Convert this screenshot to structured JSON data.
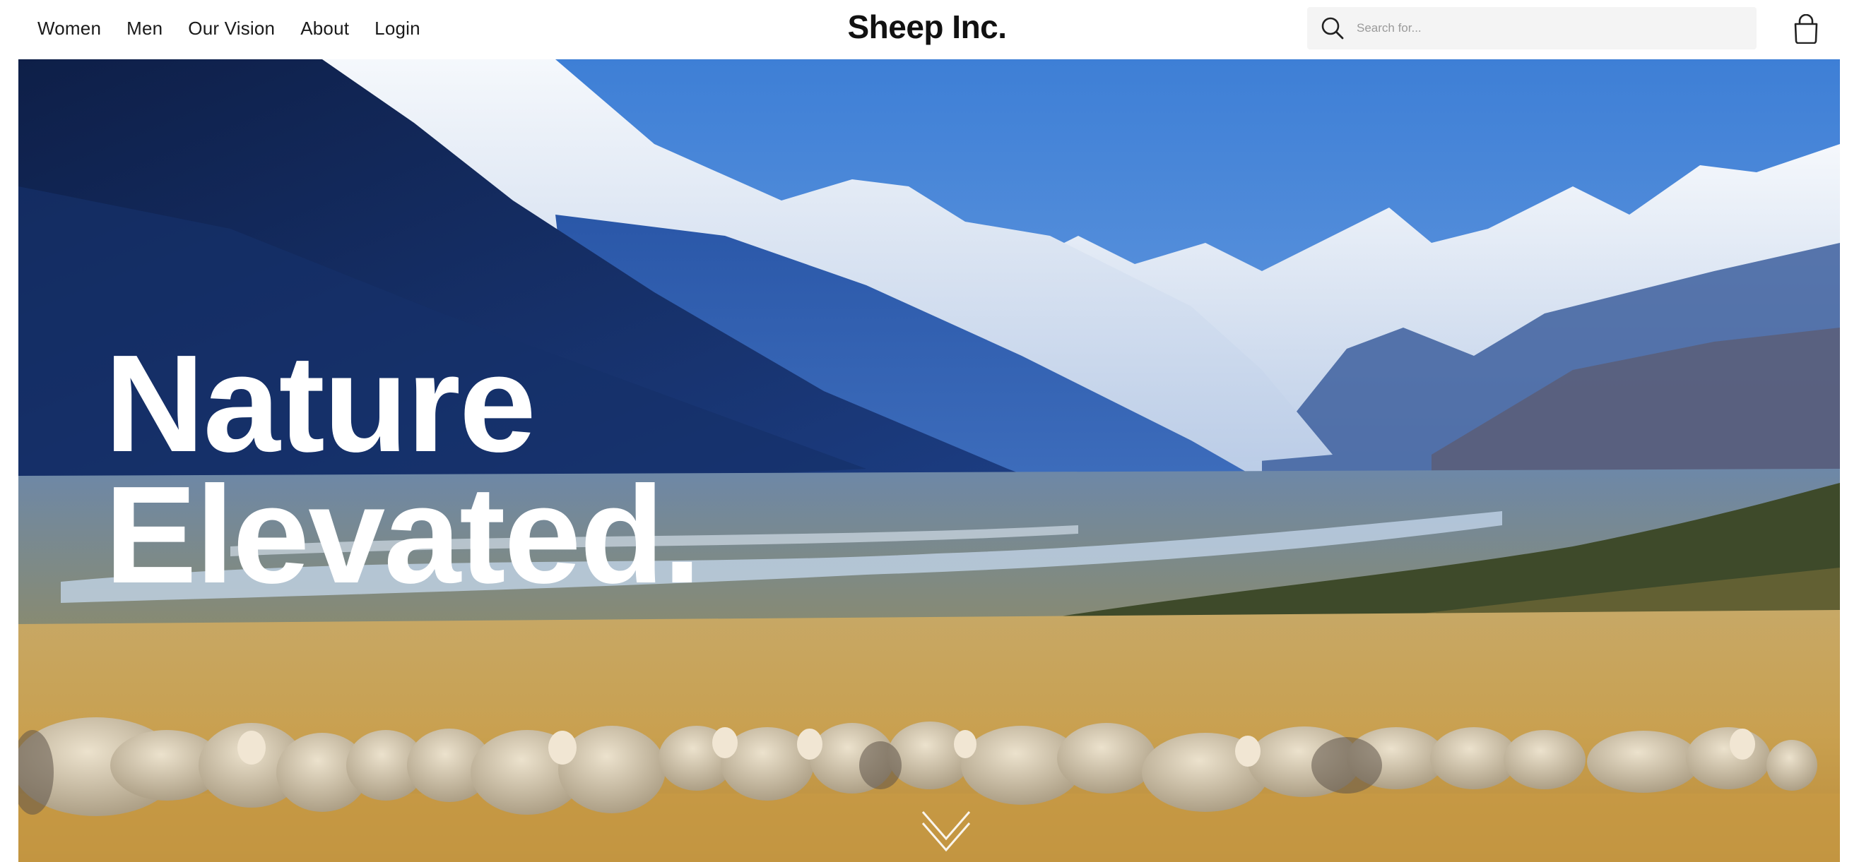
{
  "nav": {
    "items": [
      {
        "label": "Women",
        "name": "nav-women"
      },
      {
        "label": "Men",
        "name": "nav-men"
      },
      {
        "label": "Our Vision",
        "name": "nav-our-vision"
      },
      {
        "label": "About",
        "name": "nav-about"
      },
      {
        "label": "Login",
        "name": "nav-login"
      }
    ]
  },
  "brand": {
    "title": "Sheep Inc."
  },
  "search": {
    "placeholder": "Search for...",
    "value": "",
    "icon": "search-icon"
  },
  "cart": {
    "icon": "shopping-bag-icon"
  },
  "hero": {
    "headline_line1": "Nature",
    "headline_line2": "Elevated.",
    "scroll_icon": "chevron-down-icon",
    "image": "mountain valley with grazing merino sheep"
  },
  "colors": {
    "sky": "#4d8ad8",
    "mountain_dark": "#13295a",
    "snow": "#e8eef8",
    "grass": "#c9a557",
    "headline": "#ffffff"
  }
}
